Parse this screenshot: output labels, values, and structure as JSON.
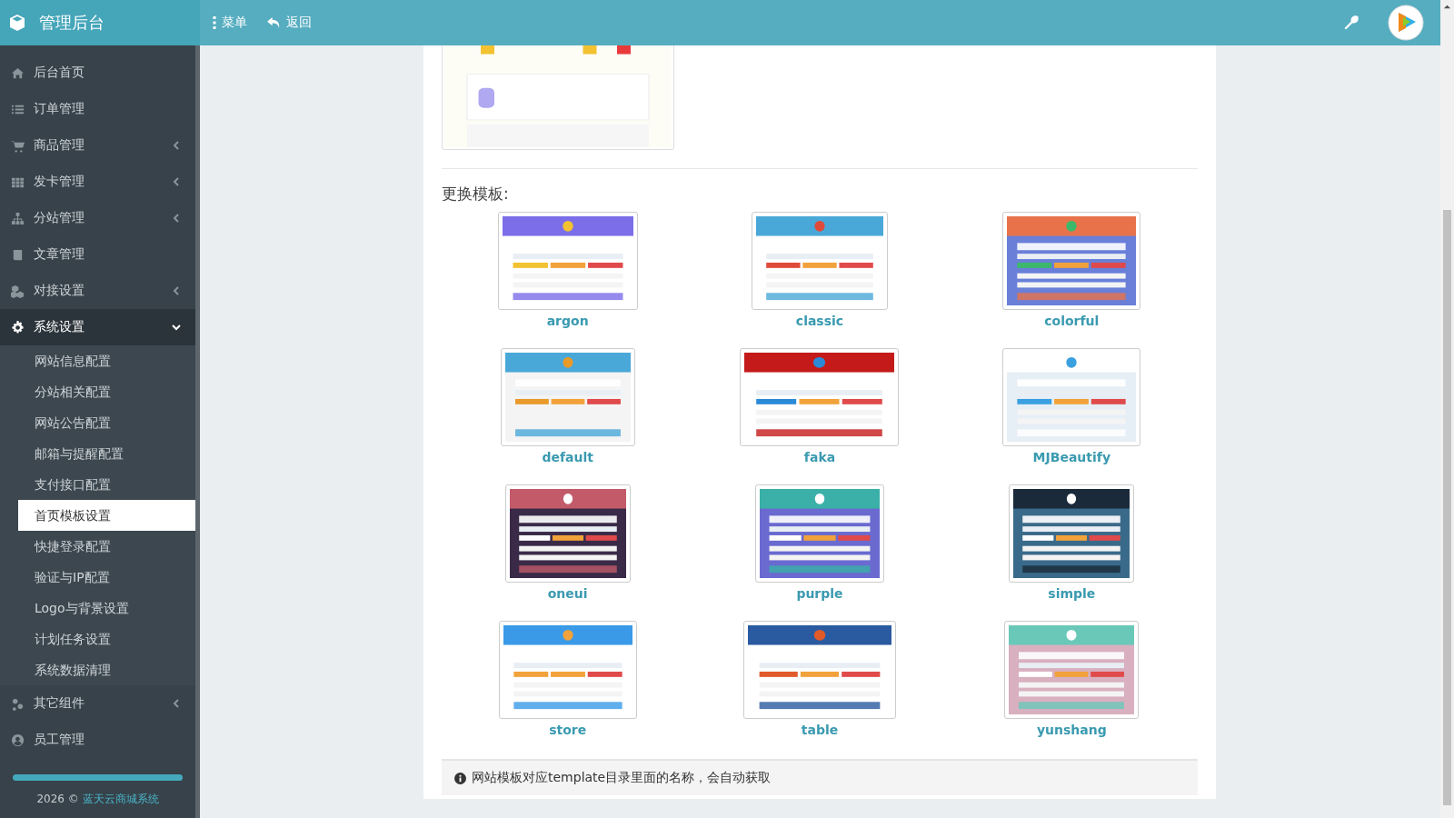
{
  "header": {
    "title": "管理后台",
    "menu_label": "菜单",
    "back_label": "返回"
  },
  "sidebar": {
    "items": [
      {
        "label": "后台首页",
        "selected": false
      },
      {
        "label": "订单管理",
        "selected": false
      },
      {
        "label": "商品管理",
        "selected": false,
        "expanded": false
      },
      {
        "label": "发卡管理",
        "selected": false,
        "expanded": false
      },
      {
        "label": "分站管理",
        "selected": false,
        "expanded": false
      },
      {
        "label": "文章管理",
        "selected": false
      },
      {
        "label": "对接设置",
        "selected": false,
        "expanded": false
      },
      {
        "label": "系统设置",
        "selected": true,
        "expanded": true,
        "children": [
          {
            "label": "网站信息配置",
            "selected": false
          },
          {
            "label": "分站相关配置",
            "selected": false
          },
          {
            "label": "网站公告配置",
            "selected": false
          },
          {
            "label": "邮箱与提醒配置",
            "selected": false
          },
          {
            "label": "支付接口配置",
            "selected": false
          },
          {
            "label": "首页模板设置",
            "selected": true
          },
          {
            "label": "快捷登录配置",
            "selected": false
          },
          {
            "label": "验证与IP配置",
            "selected": false
          },
          {
            "label": "Logo与背景设置",
            "selected": false
          },
          {
            "label": "计划任务设置",
            "selected": false
          },
          {
            "label": "系统数据清理",
            "selected": false
          }
        ]
      },
      {
        "label": "其它组件",
        "selected": false,
        "expanded": false
      },
      {
        "label": "员工管理",
        "selected": false
      }
    ],
    "footer": {
      "year": "2026 ©",
      "link": "蓝天云商城系统"
    }
  },
  "change_title": "更换模板:",
  "templates": [
    {
      "name": "argon"
    },
    {
      "name": "classic"
    },
    {
      "name": "colorful"
    },
    {
      "name": "default"
    },
    {
      "name": "faka"
    },
    {
      "name": "MJBeautify"
    },
    {
      "name": "oneui"
    },
    {
      "name": "purple"
    },
    {
      "name": "simple"
    },
    {
      "name": "store"
    },
    {
      "name": "table"
    },
    {
      "name": "yunshang"
    }
  ],
  "note": "网站模板对应template目录里面的名称，会自动获取"
}
